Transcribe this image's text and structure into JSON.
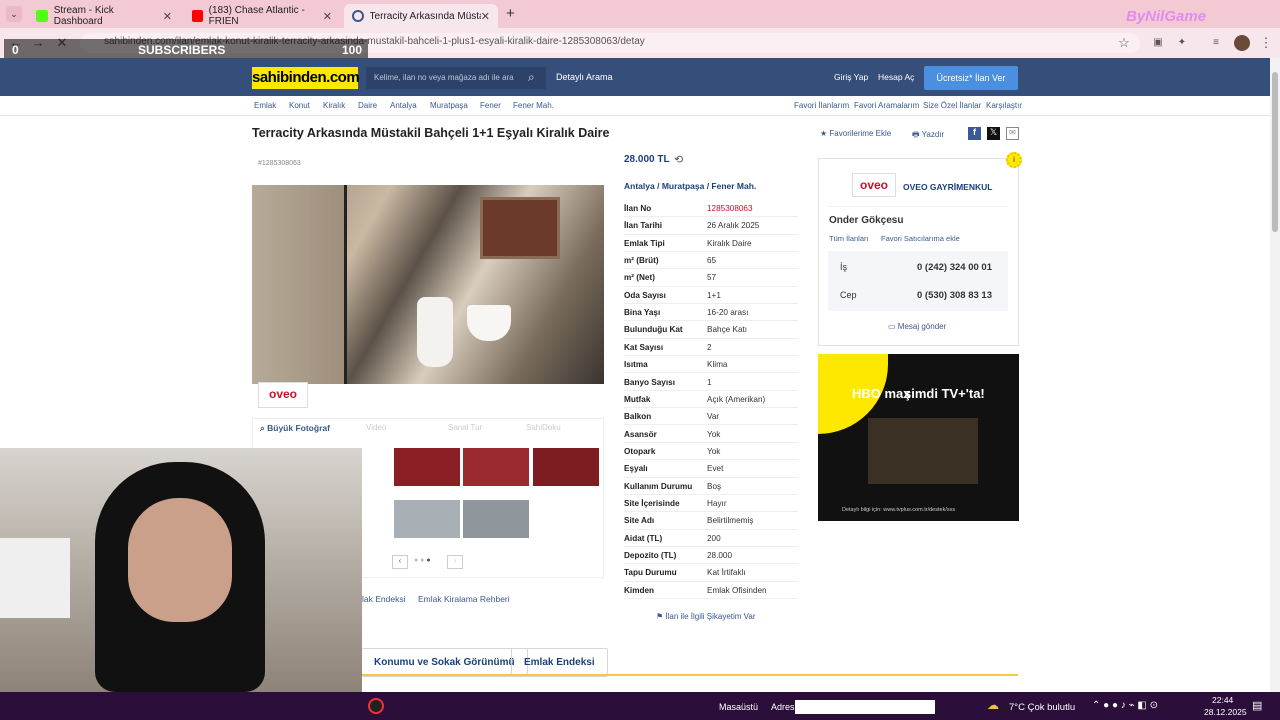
{
  "browser": {
    "tabs": [
      {
        "title": "Stream - Kick Dashboard",
        "color": "#53fc18"
      },
      {
        "title": "(183) Chase Atlantic - FRIEN",
        "color": "#ff0000"
      },
      {
        "title": "Terracity Arkasında Müstakil Ba",
        "color": "#3a5a8c"
      }
    ],
    "new_tab": "+",
    "url": "sahibinden.com/ilan/emlak-konut-kiralik-terracity-arkasinda-mustakil-bahceli-1-plus1-esyali-kiralik-daire-1285308063/detay",
    "watermark": "ByNilGame"
  },
  "overlay": {
    "left_count": "0",
    "label": "SUBSCRIBERS",
    "right_count": "100"
  },
  "site": {
    "logo": "sahibinden.com",
    "search_placeholder": "Kelime, ilan no veya mağaza adı ile ara",
    "detailed_search": "Detaylı Arama",
    "login": "Giriş Yap",
    "register": "Hesap Aç",
    "free_ad": "Ücretsiz* İlan Ver",
    "breadcrumb": [
      "Emlak",
      "Konut",
      "Kiralık",
      "Daire",
      "Antalya",
      "Muratpaşa",
      "Fener",
      "Fener Mah."
    ],
    "right_links": [
      "Favori İlanlarım",
      "Favori Aramalarım",
      "Size Özel İlanlar",
      "Karşılaştır"
    ]
  },
  "listing": {
    "title": "Terracity Arkasında Müstakil Bahçeli 1+1 Eşyalı Kiralık Daire",
    "id_label": "#1285308063",
    "favorite": "Favorilerime Ekle",
    "print": "Yazdır",
    "price": "28.000 TL",
    "location": [
      "Antalya",
      "Muratpaşa",
      "Fener Mah."
    ],
    "photo_tabs": [
      "Büyük Fotoğraf",
      "Video",
      "Sanal Tur",
      "SahiDoku"
    ],
    "photo_logo": "oveo",
    "details": [
      {
        "k": "İlan No",
        "v": "1285308063"
      },
      {
        "k": "İlan Tarihi",
        "v": "26 Aralık 2025"
      },
      {
        "k": "Emlak Tipi",
        "v": "Kiralık Daire"
      },
      {
        "k": "m² (Brüt)",
        "v": "65"
      },
      {
        "k": "m² (Net)",
        "v": "57"
      },
      {
        "k": "Oda Sayısı",
        "v": "1+1"
      },
      {
        "k": "Bina Yaşı",
        "v": "16-20 arası"
      },
      {
        "k": "Bulunduğu Kat",
        "v": "Bahçe Katı"
      },
      {
        "k": "Kat Sayısı",
        "v": "2"
      },
      {
        "k": "Isıtma",
        "v": "Klima"
      },
      {
        "k": "Banyo Sayısı",
        "v": "1"
      },
      {
        "k": "Mutfak",
        "v": "Açık (Amerikan)"
      },
      {
        "k": "Balkon",
        "v": "Var"
      },
      {
        "k": "Asansör",
        "v": "Yok"
      },
      {
        "k": "Otopark",
        "v": "Yok"
      },
      {
        "k": "Eşyalı",
        "v": "Evet"
      },
      {
        "k": "Kullanım Durumu",
        "v": "Boş"
      },
      {
        "k": "Site İçerisinde",
        "v": "Hayır"
      },
      {
        "k": "Site Adı",
        "v": "Belirtilmemiş"
      },
      {
        "k": "Aidat (TL)",
        "v": "200"
      },
      {
        "k": "Depozito (TL)",
        "v": "28.000"
      },
      {
        "k": "Tapu Durumu",
        "v": "Kat İrtifaklı"
      },
      {
        "k": "Kimden",
        "v": "Emlak Ofisinden"
      }
    ],
    "complaint": "İlan ile İlgili Şikayetim Var",
    "links_below": [
      "lak Endeksi",
      "Emlak Kiralama Rehberi"
    ],
    "bottom_tabs": [
      "Konumu ve Sokak Görünümü",
      "Emlak Endeksi"
    ]
  },
  "seller": {
    "logo": "oveo",
    "company": "OVEO GAYRİMENKUL",
    "agent": "Onder Gökçesu",
    "all_ads": "Tüm İlanları",
    "fav_seller": "Favori Satıcılarıma ekle",
    "phones": [
      {
        "label": "İş",
        "number": "0 (242) 324 00 01"
      },
      {
        "label": "Cep",
        "number": "0 (530) 308 83 13"
      }
    ],
    "message": "Mesaj gönder"
  },
  "ad": {
    "line1": "HBO max",
    "line2": "şimdi TV+'ta!",
    "footer": "Detaylı bilgi için: www.tvplus.com.tr/destek/sss"
  },
  "taskbar": {
    "desktop": "Masaüstü",
    "address_label": "Adres",
    "weather": "7°C Çok bulutlu",
    "time": "22:44",
    "date": "28.12.2025"
  }
}
